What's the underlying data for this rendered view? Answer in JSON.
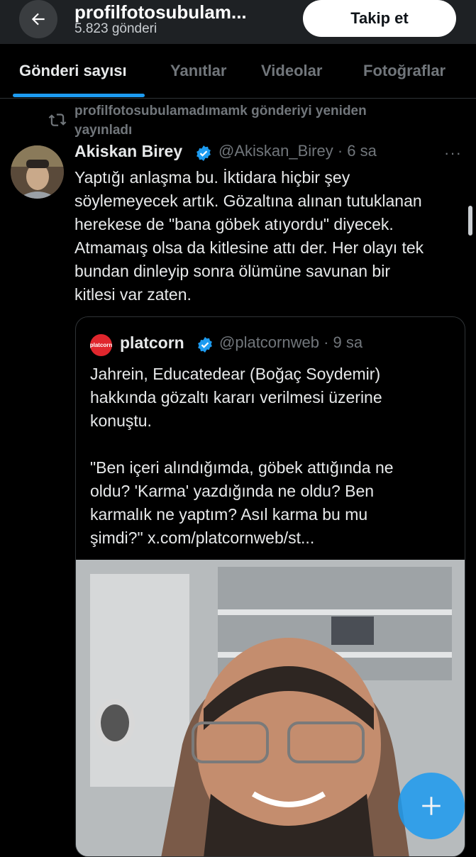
{
  "header": {
    "title": "profilfotosubulam...",
    "post_count": "5.823 gönderi",
    "follow_label": "Takip et"
  },
  "tabs": [
    {
      "label": "Gönderi sayısı",
      "active": true
    },
    {
      "label": "Yanıtlar",
      "active": false
    },
    {
      "label": "Videolar",
      "active": false
    },
    {
      "label": "Fotoğraflar",
      "active": false
    }
  ],
  "repost": {
    "text": "profilfotosubulamadımamk gönderiyi yeniden yayınladı",
    "icon": "repost-icon"
  },
  "tweet": {
    "display_name": "Akiskan Birey",
    "handle_time": "@Akiskan_Birey · 6 sa",
    "more": "···",
    "body": "Yaptığı anlaşma bu. İktidara hiçbir şey\nsöylemeyecek artık. Gözaltına alınan tutuklanan\nherekese de \"bana göbek atıyordu\" diyecek.\nAtmamaış olsa da kitlesine attı der. Her olayı tek\nbundan dinleyip sonra ölümüne savunan bir\nkitlesi var zaten."
  },
  "quote": {
    "logo_text": "platcorn",
    "display_name": "platcorn",
    "handle_time": "@platcornweb · 9 sa",
    "body": "Jahrein, Educatedear (Boğaç Soydemir)\nhakkında gözaltı kararı verilmesi üzerine\nkonuştu.\n\n\"Ben içeri alındığımda, göbek attığında ne\noldu? 'Karma' yazdığında ne oldu? Ben\nkarmalık ne yaptım? Asıl karma bu mu\nşimdi?\" x.com/platcornweb/st..."
  },
  "colors": {
    "accent": "#1d9bf0",
    "background": "#000000",
    "secondary_text": "#71767b"
  },
  "fab": {
    "icon": "plus-icon"
  }
}
